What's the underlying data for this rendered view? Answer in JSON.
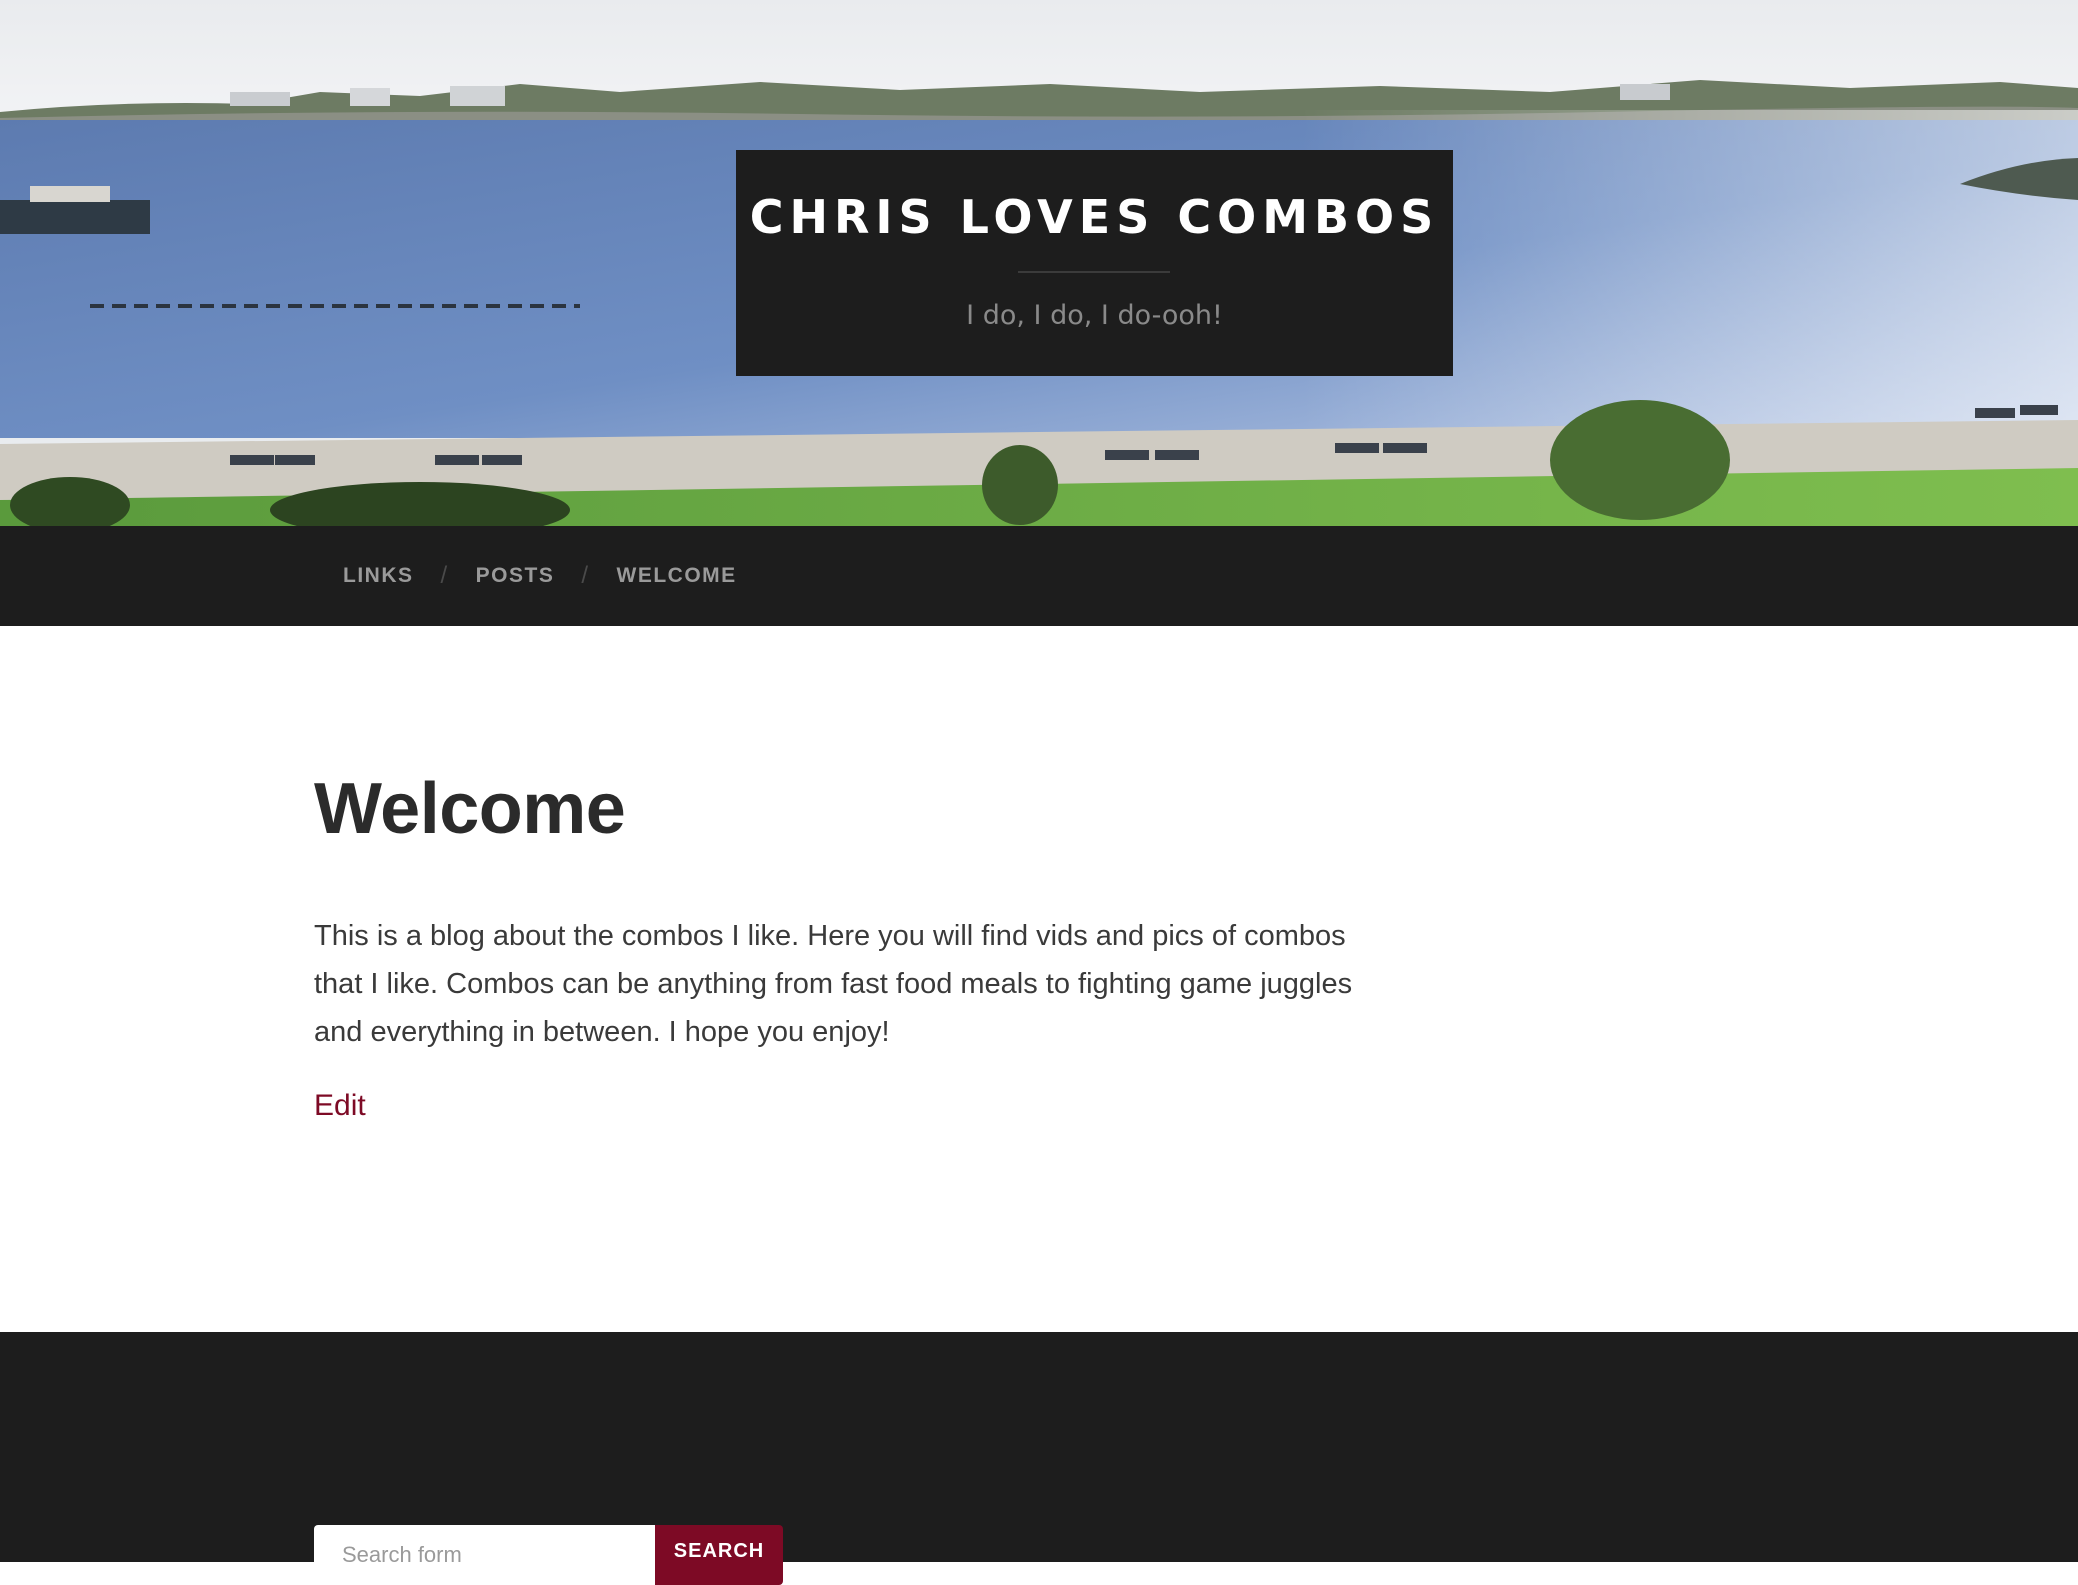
{
  "header": {
    "site_title": "CHRIS LOVES COMBOS",
    "tagline": "I do, I do, I do-ooh!"
  },
  "nav": {
    "items": [
      {
        "label": "LINKS"
      },
      {
        "label": "POSTS"
      },
      {
        "label": "WELCOME"
      }
    ],
    "separator": "/"
  },
  "page": {
    "title": "Welcome",
    "body": "This is a blog about the combos I like. Here you will find vids and pics of combos that I like. Combos can be anything from fast food meals to fighting game juggles and everything in between. I hope you enjoy!",
    "edit_label": "Edit"
  },
  "footer": {
    "search": {
      "placeholder": "Search form",
      "button_label": "SEARCH"
    }
  },
  "colors": {
    "accent": "#7d0a25",
    "dark_background": "#1d1d1d"
  }
}
